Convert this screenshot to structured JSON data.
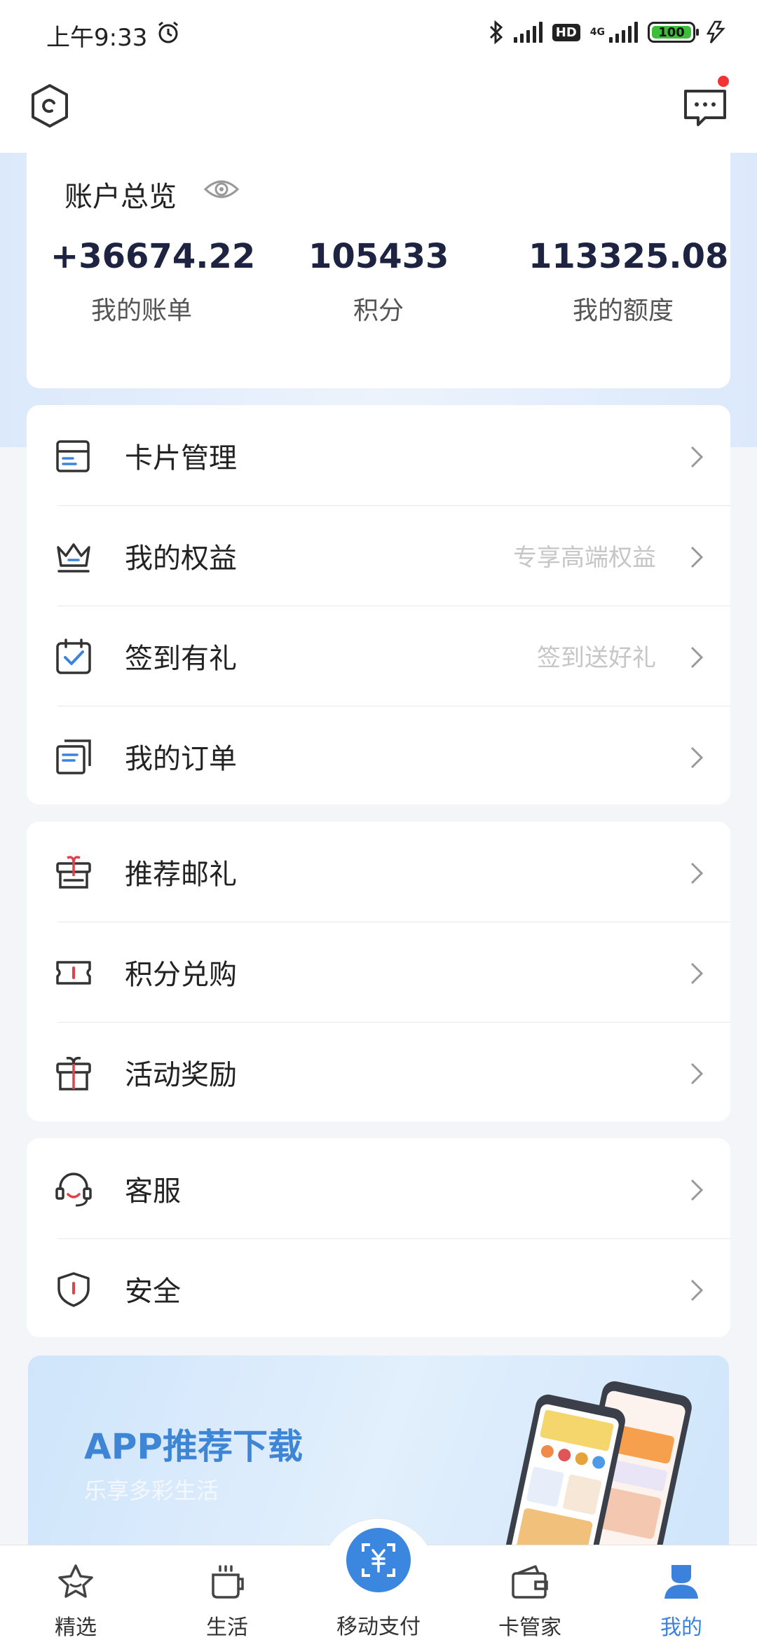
{
  "status_bar": {
    "time": "上午9:33",
    "network_type": "4G",
    "hd_label": "HD",
    "battery": "100"
  },
  "header": {
    "settings_icon": "settings-gear-icon",
    "message_icon": "chat-bubble-icon",
    "has_unread": true
  },
  "overview": {
    "title": "账户总览",
    "stats": [
      {
        "value": "+36674.22",
        "label": "我的账单"
      },
      {
        "value": "105433",
        "label": "积分"
      },
      {
        "value": "113325.08",
        "label": "我的额度"
      }
    ]
  },
  "menu_groups": [
    {
      "items": [
        {
          "label": "卡片管理",
          "hint": "",
          "icon": "card-icon"
        },
        {
          "label": "我的权益",
          "hint": "专享高端权益",
          "icon": "crown-icon"
        },
        {
          "label": "签到有礼",
          "hint": "签到送好礼",
          "icon": "calendar-check-icon"
        },
        {
          "label": "我的订单",
          "hint": "",
          "icon": "orders-icon"
        }
      ]
    },
    {
      "items": [
        {
          "label": "推荐邮礼",
          "hint": "",
          "icon": "referral-gift-icon"
        },
        {
          "label": "积分兑购",
          "hint": "",
          "icon": "ticket-icon"
        },
        {
          "label": "活动奖励",
          "hint": "",
          "icon": "gift-box-icon"
        }
      ]
    },
    {
      "items": [
        {
          "label": "客服",
          "hint": "",
          "icon": "headset-icon"
        },
        {
          "label": "安全",
          "hint": "",
          "icon": "shield-icon"
        }
      ]
    }
  ],
  "banner": {
    "title": "APP推荐下载",
    "subtitle": "乐享多彩生活"
  },
  "tabbar": {
    "tabs": [
      {
        "label": "精选",
        "icon": "star-icon",
        "active": false
      },
      {
        "label": "生活",
        "icon": "cup-icon",
        "active": false
      },
      {
        "label": "移动支付",
        "icon": "scan-pay-icon",
        "active": false
      },
      {
        "label": "卡管家",
        "icon": "wallet-icon",
        "active": false
      },
      {
        "label": "我的",
        "icon": "user-icon",
        "active": true
      }
    ]
  },
  "colors": {
    "accent": "#3b82dc",
    "badge_red": "#f03434",
    "menu_icon_blue": "#3a84e0",
    "menu_icon_red": "#e0424a",
    "value_dark": "#1d2340"
  }
}
